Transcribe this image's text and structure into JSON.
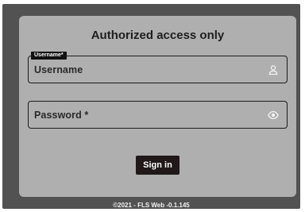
{
  "login": {
    "title": "Authorized access only",
    "username": {
      "label": "Username*",
      "value": "Username",
      "icon": "person-icon"
    },
    "password": {
      "placeholder": "Password *",
      "icon": "eye-icon"
    },
    "signin_label": "Sign in"
  },
  "footer": {
    "text": "©2021 - FLS Web -0.1.145"
  },
  "colors": {
    "page_frame": "#525252",
    "card": "#afafaf",
    "button": "#201819",
    "label_badge": "#111111"
  }
}
